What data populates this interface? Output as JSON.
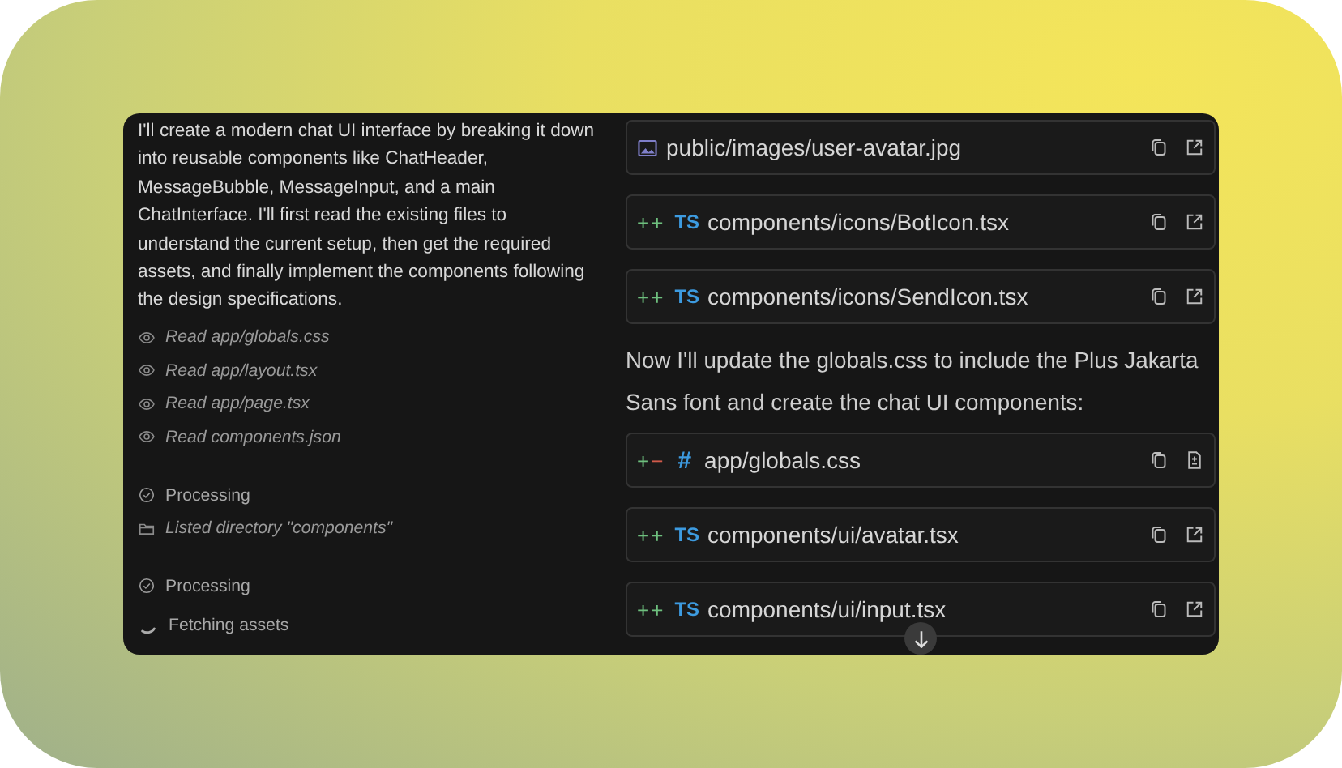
{
  "message": {
    "text": "I'll create a modern chat UI interface by breaking it down into reusable components like ChatHeader, MessageBubble, MessageInput, and a main ChatInterface. I'll first read the existing files to understand the current setup, then get the required assets, and finally implement the components following the design specifications."
  },
  "log": [
    {
      "kind": "read",
      "text": "Read app/globals.css"
    },
    {
      "kind": "read",
      "text": "Read app/layout.tsx"
    },
    {
      "kind": "read",
      "text": "Read app/page.tsx"
    },
    {
      "kind": "read",
      "text": "Read components.json"
    },
    {
      "kind": "processing",
      "text": "Processing"
    },
    {
      "kind": "listed",
      "text": "Listed directory \"components\""
    },
    {
      "kind": "processing",
      "text": "Processing"
    },
    {
      "kind": "fetching",
      "text": "Fetching assets"
    }
  ],
  "files_top": [
    {
      "kind": "asset",
      "path": "public/images/user-avatar.jpg"
    },
    {
      "kind": "added",
      "prefix": "++",
      "lang": "TS",
      "path": "components/icons/BotIcon.tsx"
    },
    {
      "kind": "added",
      "prefix": "++",
      "lang": "TS",
      "path": "components/icons/SendIcon.tsx"
    }
  ],
  "note": "Now I'll update the globals.css to include the Plus Jakarta Sans font and create the chat UI components:",
  "files_bottom": [
    {
      "kind": "modified",
      "prefix": "+−",
      "lang": "#",
      "path": "app/globals.css"
    },
    {
      "kind": "added",
      "prefix": "++",
      "lang": "TS",
      "path": "components/ui/avatar.tsx"
    },
    {
      "kind": "added",
      "prefix": "++",
      "lang": "TS",
      "path": "components/ui/input.tsx"
    }
  ]
}
